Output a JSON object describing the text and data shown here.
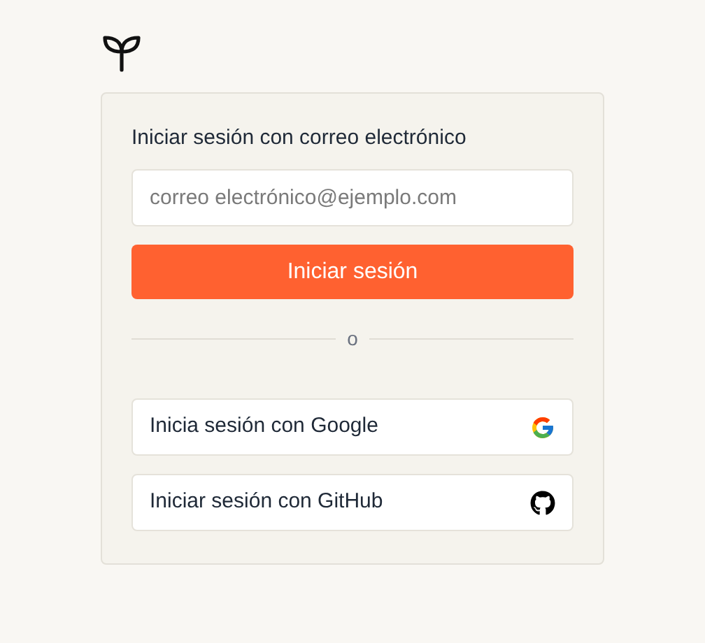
{
  "form": {
    "heading": "Iniciar sesión con correo electrónico",
    "email": {
      "placeholder": "correo electrónico@ejemplo.com"
    },
    "submit": "Iniciar sesión"
  },
  "divider": "o",
  "providers": [
    {
      "kind": "google",
      "label": "Inicia sesión con Google"
    },
    {
      "kind": "github",
      "label": "Iniciar sesión con GitHub"
    }
  ]
}
